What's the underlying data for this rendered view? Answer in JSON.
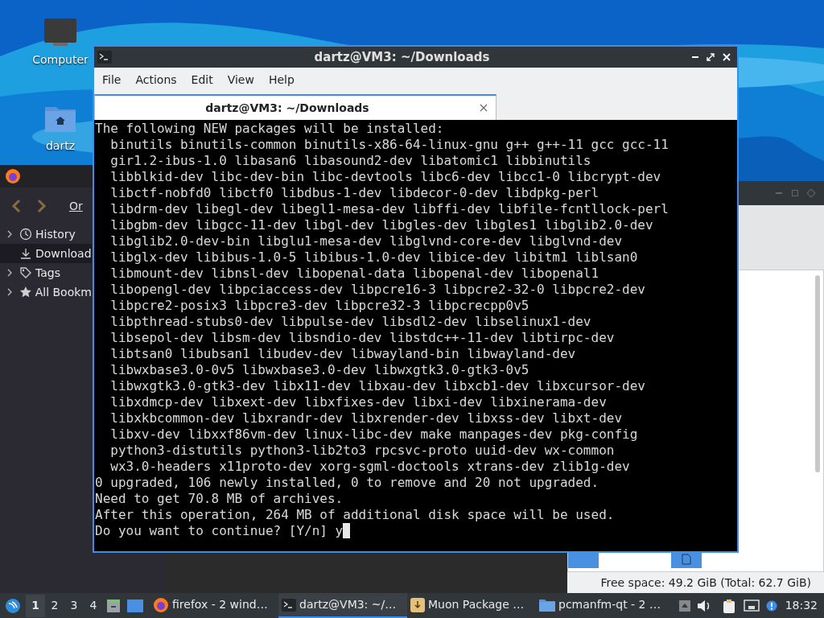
{
  "desktop_icons": [
    {
      "label": "Computer",
      "kind": "computer"
    },
    {
      "label": "dartz",
      "kind": "home"
    }
  ],
  "library_window": {
    "toolbar_label": "Or",
    "tree": [
      {
        "label": "History",
        "expanded": false,
        "selected": false,
        "kind": "history"
      },
      {
        "label": "Download",
        "selected": true,
        "kind": "downloads"
      },
      {
        "label": "Tags",
        "expanded": false,
        "selected": false,
        "kind": "tags"
      },
      {
        "label": "All Bookm",
        "expanded": false,
        "selected": false,
        "kind": "bookmarks"
      }
    ]
  },
  "file_manager": {
    "status": "Free space: 49.2 GiB (Total: 62.7 GiB)"
  },
  "terminal": {
    "title": "dartz@VM3: ~/Downloads",
    "menu": [
      "File",
      "Actions",
      "Edit",
      "View",
      "Help"
    ],
    "tabs": [
      {
        "label": "dartz@VM3: ~/Downloads",
        "selected": true
      }
    ],
    "lines": [
      "The following NEW packages will be installed:",
      "  binutils binutils-common binutils-x86-64-linux-gnu g++ g++-11 gcc gcc-11",
      "  gir1.2-ibus-1.0 libasan6 libasound2-dev libatomic1 libbinutils",
      "  libblkid-dev libc-dev-bin libc-devtools libc6-dev libcc1-0 libcrypt-dev",
      "  libctf-nobfd0 libctf0 libdbus-1-dev libdecor-0-dev libdpkg-perl",
      "  libdrm-dev libegl-dev libegl1-mesa-dev libffi-dev libfile-fcntllock-perl",
      "  libgbm-dev libgcc-11-dev libgl-dev libgles-dev libgles1 libglib2.0-dev",
      "  libglib2.0-dev-bin libglu1-mesa-dev libglvnd-core-dev libglvnd-dev",
      "  libglx-dev libibus-1.0-5 libibus-1.0-dev libice-dev libitm1 liblsan0",
      "  libmount-dev libnsl-dev libopenal-data libopenal-dev libopenal1",
      "  libopengl-dev libpciaccess-dev libpcre16-3 libpcre2-32-0 libpcre2-dev",
      "  libpcre2-posix3 libpcre3-dev libpcre32-3 libpcrecpp0v5",
      "  libpthread-stubs0-dev libpulse-dev libsdl2-dev libselinux1-dev",
      "  libsepol-dev libsm-dev libsndio-dev libstdc++-11-dev libtirpc-dev",
      "  libtsan0 libubsan1 libudev-dev libwayland-bin libwayland-dev",
      "  libwxbase3.0-0v5 libwxbase3.0-dev libwxgtk3.0-gtk3-0v5",
      "  libwxgtk3.0-gtk3-dev libx11-dev libxau-dev libxcb1-dev libxcursor-dev",
      "  libxdmcp-dev libxext-dev libxfixes-dev libxi-dev libxinerama-dev",
      "  libxkbcommon-dev libxrandr-dev libxrender-dev libxss-dev libxt-dev",
      "  libxv-dev libxxf86vm-dev linux-libc-dev make manpages-dev pkg-config",
      "  python3-distutils python3-lib2to3 rpcsvc-proto uuid-dev wx-common",
      "  wx3.0-headers x11proto-dev xorg-sgml-doctools xtrans-dev zlib1g-dev",
      "0 upgraded, 106 newly installed, 0 to remove and 20 not upgraded.",
      "Need to get 70.8 MB of archives.",
      "After this operation, 264 MB of additional disk space will be used.",
      "Do you want to continue? [Y/n] y"
    ]
  },
  "taskbar": {
    "workspaces": [
      {
        "label": "1",
        "selected": true
      },
      {
        "label": "2",
        "selected": false
      },
      {
        "label": "3",
        "selected": false
      },
      {
        "label": "4",
        "selected": false
      }
    ],
    "tasks": [
      {
        "label": "firefox - 2 wind…",
        "kind": "firefox",
        "selected": false
      },
      {
        "label": "dartz@VM3: ~/…",
        "kind": "terminal",
        "selected": true
      },
      {
        "label": "Muon Package …",
        "kind": "package",
        "selected": false
      },
      {
        "label": "pcmanfm-qt - 2 …",
        "kind": "folder",
        "selected": false
      }
    ],
    "clock": "18:32"
  }
}
